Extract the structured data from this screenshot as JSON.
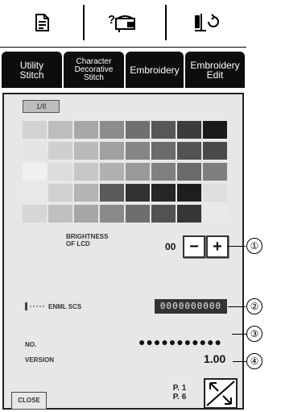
{
  "top_icons": [
    {
      "name": "pattern-list-icon"
    },
    {
      "name": "help-sewing-icon"
    },
    {
      "name": "needle-thread-icon"
    }
  ],
  "tabs": [
    {
      "label": "Utility\nStitch"
    },
    {
      "label": "Character\nDecorative\nStitch"
    },
    {
      "label": "Embroidery"
    },
    {
      "label": "Embroidery\nEdit"
    }
  ],
  "settings": {
    "page_tab": "1/8",
    "brightness_label": "BRIGHTNESS\nOF LCD",
    "brightness_value": "00",
    "minus_label": "−",
    "plus_label": "+",
    "model_value": "ENML SCS",
    "model_number": "0000000000",
    "no_label": "NO.",
    "no_value": "●●●●●●●●●●●",
    "version_label": "VERSION",
    "version_value": "1.00",
    "close_label": "CLOSE",
    "page_indicator": "P. 1\nP. 6"
  },
  "callouts": [
    "①",
    "②",
    "③",
    "④"
  ],
  "palette_rows": [
    [
      "#d2d2d2",
      "#bdbdbd",
      "#a8a8a8",
      "#8c8c8c",
      "#707070",
      "#575757",
      "#3c3c3c",
      "#1a1a1a"
    ],
    [
      "#e4e4e4",
      "#cfcfcf",
      "#bababa",
      "#a0a0a0",
      "#858585",
      "#6b6b6b",
      "#535353",
      "#4a4a4a"
    ],
    [
      "#f0f0f0",
      "#dcdcdc",
      "#c7c7c7",
      "#b0b0b0",
      "#999999",
      "#808080",
      "#6a6a6a",
      "#7e7e7e"
    ],
    [
      "#e8e8e8",
      "#d0d0d0",
      "#b4b4b4",
      "#5a5a5a",
      "#323232",
      "#262626",
      "#1e1e1e",
      "#dedede"
    ],
    [
      "#d6d6d6",
      "#c0c0c0",
      "#a6a6a6",
      "#8a8a8a",
      "#6e6e6e",
      "#525252",
      "#363636",
      "#e9e9e9"
    ]
  ]
}
